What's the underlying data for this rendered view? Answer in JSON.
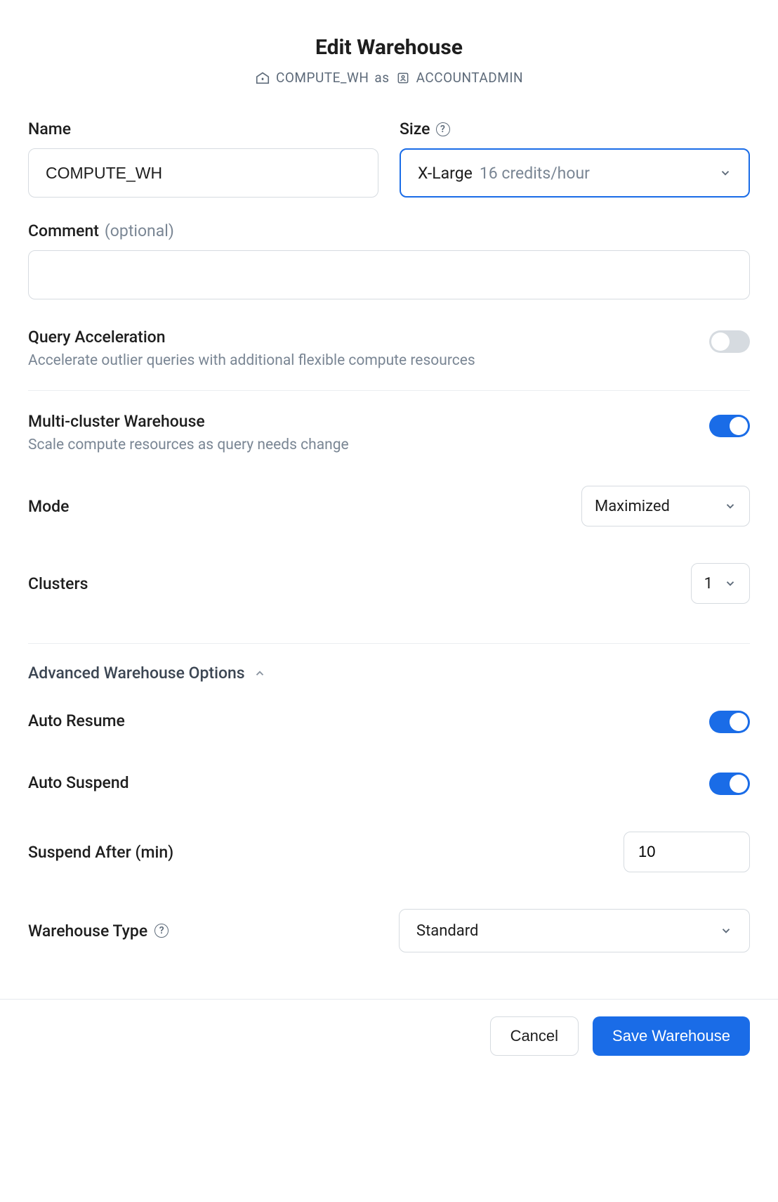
{
  "header": {
    "title": "Edit Warehouse",
    "warehouse_name": "COMPUTE_WH",
    "as_label": "as",
    "role_name": "ACCOUNTADMIN"
  },
  "fields": {
    "name_label": "Name",
    "name_value": "COMPUTE_WH",
    "size_label": "Size",
    "size_selected": "X-Large",
    "size_sub": "16 credits/hour",
    "comment_label": "Comment",
    "comment_optional": "(optional)",
    "comment_value": ""
  },
  "query_accel": {
    "title": "Query Acceleration",
    "desc": "Accelerate outlier queries with additional flexible compute resources",
    "on": false
  },
  "multi_cluster": {
    "title": "Multi-cluster Warehouse",
    "desc": "Scale compute resources as query needs change",
    "on": true,
    "mode_label": "Mode",
    "mode_value": "Maximized",
    "clusters_label": "Clusters",
    "clusters_value": "1"
  },
  "advanced": {
    "heading": "Advanced Warehouse Options",
    "auto_resume_label": "Auto Resume",
    "auto_resume_on": true,
    "auto_suspend_label": "Auto Suspend",
    "auto_suspend_on": true,
    "suspend_after_label": "Suspend After (min)",
    "suspend_after_value": "10",
    "type_label": "Warehouse Type",
    "type_value": "Standard"
  },
  "footer": {
    "cancel": "Cancel",
    "save": "Save Warehouse"
  }
}
